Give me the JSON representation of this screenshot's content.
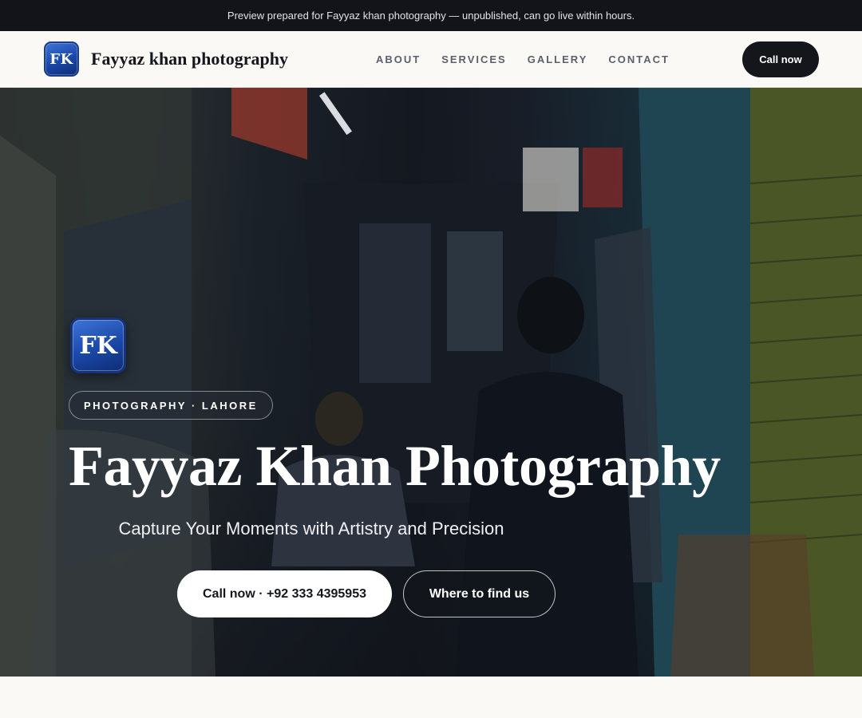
{
  "announcement": "Preview prepared for Fayyaz khan photography — unpublished, can go live within hours.",
  "header": {
    "logo_initials": "FK",
    "brand_name": "Fayyaz khan photography",
    "nav": [
      {
        "label": "ABOUT"
      },
      {
        "label": "SERVICES"
      },
      {
        "label": "GALLERY"
      },
      {
        "label": "CONTACT"
      }
    ],
    "call_label": "Call now"
  },
  "hero": {
    "logo_initials": "FK",
    "tag": "PHOTOGRAPHY · LAHORE",
    "title": "Fayyaz Khan Photography",
    "subtitle": "Capture Your Moments with Artistry and Precision",
    "primary_cta": "Call now · +92 333 4395953",
    "secondary_cta": "Where to find us",
    "background": "market-alley-photo"
  },
  "colors": {
    "dark": "#14161c",
    "logo_blue": "#1a47a8",
    "page_bg": "#faf9f6"
  }
}
